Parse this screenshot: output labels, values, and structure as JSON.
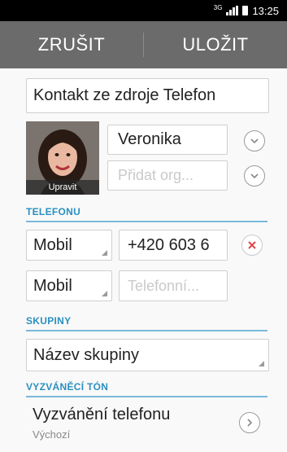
{
  "status": {
    "network": "3G",
    "time": "13:25"
  },
  "actionbar": {
    "cancel": "ZRUŠIT",
    "save": "ULOŽIT"
  },
  "contact": {
    "source": "Kontakt ze zdroje Telefon",
    "photo_label": "Upravit",
    "name": "Veronika",
    "org_placeholder": "Přidat org..."
  },
  "phone": {
    "header": "TELEFONU",
    "rows": [
      {
        "type": "Mobil",
        "value": "+420 603 6",
        "placeholder": ""
      },
      {
        "type": "Mobil",
        "value": "",
        "placeholder": "Telefonní..."
      }
    ]
  },
  "groups": {
    "header": "SKUPINY",
    "value": "Název skupiny"
  },
  "ringtone": {
    "header": "VYZVÁNĚCÍ TÓN",
    "title": "Vyzvánění telefonu",
    "value": "Výchozí"
  },
  "colors": {
    "accent": "#2a8fbf",
    "actionbar": "#6b6b6b",
    "remove": "#e0474c"
  }
}
